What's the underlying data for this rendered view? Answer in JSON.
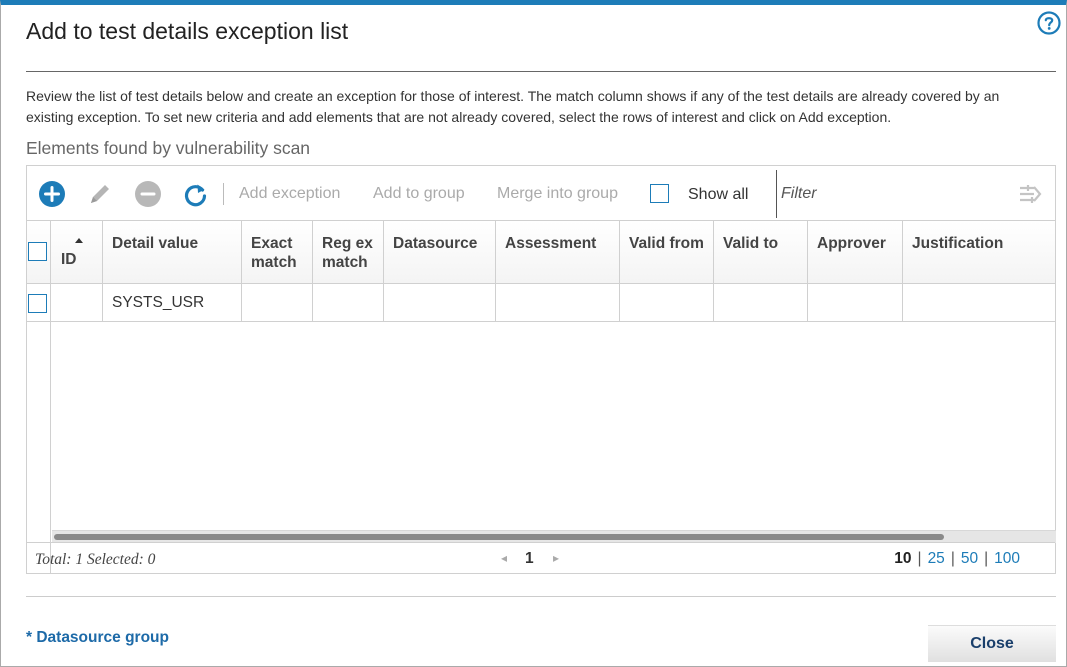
{
  "dialog": {
    "title": "Add to test details exception list",
    "description": "Review the list of test details below and create an exception for those of interest. The match column shows if any of the test details are already covered by an existing exception. To set new criteria and add elements that are not already covered, select the rows of interest and click on Add exception.",
    "section_title": "Elements found by vulnerability scan",
    "help_icon": "help-circle-icon"
  },
  "toolbar": {
    "icons": [
      "add-circle-icon",
      "pencil-edit-icon",
      "remove-circle-icon",
      "refresh-icon"
    ],
    "add_exception": "Add exception",
    "add_to_group": "Add to group",
    "merge_into_group": "Merge into group",
    "show_all": "Show all",
    "filter_placeholder": "Filter",
    "filter_icon": "filter-settings-icon"
  },
  "table": {
    "columns": [
      "ID",
      "Detail value",
      "Exact match",
      "Reg ex match",
      "Datasource",
      "Assessment",
      "Valid from",
      "Valid to",
      "Approver",
      "Justification"
    ],
    "rows": [
      {
        "id": "",
        "detail_value": "SYSTS_USR",
        "exact_match": "",
        "regex_match": "",
        "datasource": "",
        "assessment": "",
        "valid_from": "",
        "valid_to": "",
        "approver": "",
        "justification": ""
      }
    ]
  },
  "footer": {
    "total_text": "Total: 1 Selected: 0",
    "prev_glyph": "◂",
    "next_glyph": "▸",
    "current_page": "1",
    "page_sizes": [
      "10",
      "25",
      "50",
      "100"
    ],
    "active_page_size": "10"
  },
  "bottom": {
    "datasource_group": "* Datasource group",
    "close": "Close"
  },
  "colors": {
    "accent": "#1d7cb8",
    "link": "#1d6aa8",
    "disabled_text": "#aaaaaa"
  }
}
